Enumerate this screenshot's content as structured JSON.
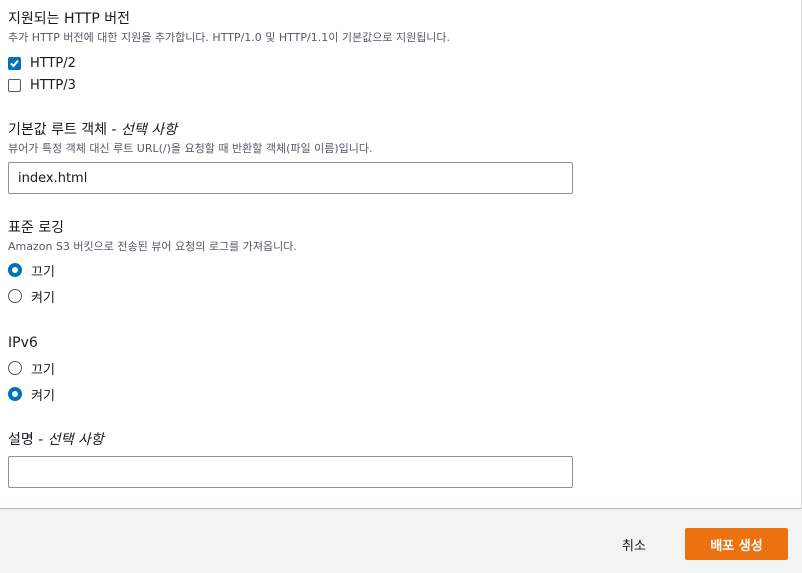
{
  "http_versions": {
    "label": "지원되는 HTTP 버전",
    "description": "추가 HTTP 버전에 대한 지원을 추가합니다. HTTP/1.0 및 HTTP/1.1이 기본값으로 지원됩니다.",
    "options": [
      {
        "label": "HTTP/2",
        "checked": true
      },
      {
        "label": "HTTP/3",
        "checked": false
      }
    ]
  },
  "default_root_object": {
    "label": "기본값 루트 객체 - ",
    "optional": "선택 사항",
    "description": "뷰어가 특정 객체 대신 루트 URL(/)을 요청할 때 반환할 객체(파일 이름)입니다.",
    "value": "index.html"
  },
  "standard_logging": {
    "label": "표준 로깅",
    "description": "Amazon S3 버킷으로 전송된 뷰어 요청의 로그를 가져옵니다.",
    "options": [
      {
        "label": "끄기",
        "selected": true
      },
      {
        "label": "켜기",
        "selected": false
      }
    ]
  },
  "ipv6": {
    "label": "IPv6",
    "options": [
      {
        "label": "끄기",
        "selected": false
      },
      {
        "label": "켜기",
        "selected": true
      }
    ]
  },
  "description_field": {
    "label": "설명 - ",
    "optional": "선택 사항",
    "value": ""
  },
  "footer": {
    "cancel_label": "취소",
    "create_label": "배포 생성"
  },
  "colors": {
    "accent": "#0073bb",
    "primary_button": "#ec7211"
  }
}
